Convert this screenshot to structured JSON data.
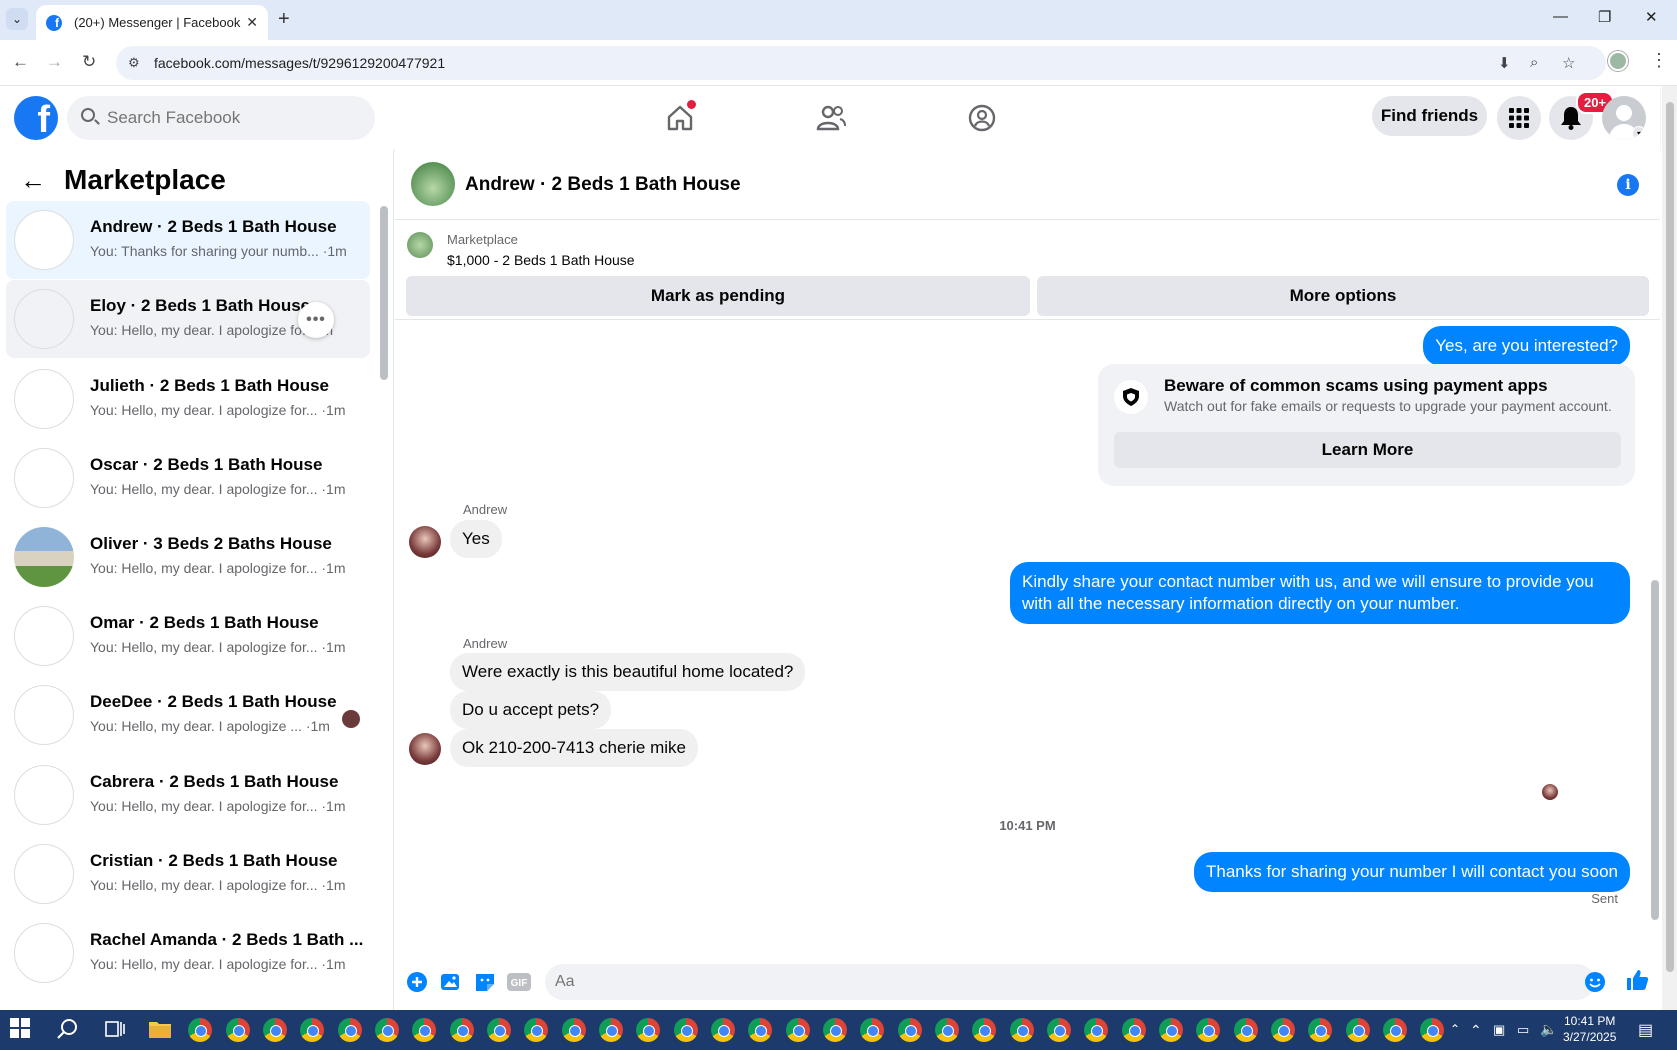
{
  "browser": {
    "tab_title": "(20+) Messenger | Facebook",
    "url": "facebook.com/messages/t/9296129200477921"
  },
  "fb_header": {
    "search_placeholder": "Search Facebook",
    "find_friends": "Find friends",
    "notification_count": "20+"
  },
  "sidebar": {
    "title": "Marketplace",
    "conversations": [
      {
        "name": "Andrew · 2 Beds 1 Bath House",
        "snippet": "You: Thanks for sharing your numb... ·1m"
      },
      {
        "name": "Eloy · 2 Beds 1 Bath House",
        "snippet": "You: Hello, my dear. I apologize fo...1m"
      },
      {
        "name": "Julieth · 2 Beds 1 Bath House",
        "snippet": "You: Hello, my dear. I apologize for... ·1m"
      },
      {
        "name": "Oscar · 2 Beds 1 Bath House",
        "snippet": "You: Hello, my dear. I apologize for... ·1m"
      },
      {
        "name": "Oliver · 3 Beds 2 Baths House",
        "snippet": "You: Hello, my dear. I apologize for... ·1m"
      },
      {
        "name": "Omar · 2 Beds 1 Bath House",
        "snippet": "You: Hello, my dear. I apologize for... ·1m"
      },
      {
        "name": "DeeDee · 2 Beds 1 Bath House",
        "snippet": "You: Hello, my dear. I apologize ... ·1m"
      },
      {
        "name": "Cabrera · 2 Beds 1 Bath House",
        "snippet": "You: Hello, my dear. I apologize for... ·1m"
      },
      {
        "name": "Cristian · 2 Beds 1 Bath House",
        "snippet": "You: Hello, my dear. I apologize for... ·1m"
      },
      {
        "name": "Rachel Amanda · 2 Beds 1 Bath ...",
        "snippet": "You: Hello, my dear. I apologize for... ·1m"
      }
    ]
  },
  "chat": {
    "title": "Andrew · 2 Beds 1 Bath House",
    "marketplace_label": "Marketplace",
    "listing": "$1,000 - 2 Beds 1 Bath House",
    "mark_pending": "Mark as pending",
    "more_options": "More options",
    "msg_out_1": "Yes, are you interested?",
    "scam_title": "Beware of common scams using payment apps",
    "scam_body": "Watch out for fake emails or requests to upgrade your payment account.",
    "learn_more": "Learn More",
    "sender_1": "Andrew",
    "msg_in_1": "Yes",
    "msg_out_2": "Kindly share your contact number with us, and we will ensure to provide you with all the necessary information directly on your number.",
    "sender_2": "Andrew",
    "msg_in_2": "Were exactly  is this beautiful  home located?",
    "msg_in_3": "Do u accept  pets?",
    "msg_in_4": "Ok 210-200-7413 cherie mike",
    "timestamp": "10:41 PM",
    "msg_out_3": "Thanks for sharing your number I will contact you soon",
    "status": "Sent",
    "composer_placeholder": "Aa"
  },
  "taskbar": {
    "time": "10:41 PM",
    "date": "3/27/2025"
  },
  "colors": {
    "fb_blue": "#1877f2",
    "messenger_blue": "#0084ff",
    "active_conv": "#ebf5ff",
    "notification_red": "#e41e3f"
  }
}
